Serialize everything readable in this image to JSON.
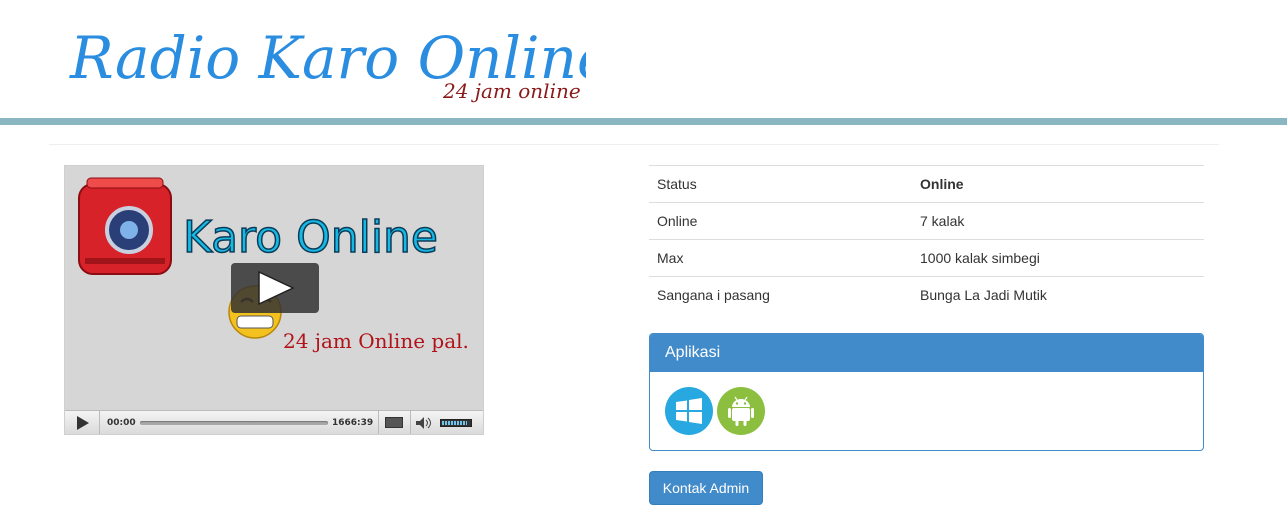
{
  "header": {
    "logo_title": "Radio Karo Online",
    "logo_tagline": "24 jam online",
    "logo_color": "#2a8de0",
    "tagline_color": "#8b1a1a",
    "bar_color": "#8ab6c1"
  },
  "player": {
    "poster_title": "Karo Online",
    "poster_caption": "24 jam Online pal.",
    "current_time": "00:00",
    "duration": "1666:39",
    "volume_level": 0.9,
    "icons": {
      "big_play": "play-icon",
      "play": "play-icon",
      "fullscreen": "screen-icon",
      "volume": "speaker-icon"
    }
  },
  "info": {
    "rows": [
      {
        "key": "Status",
        "value": "Online"
      },
      {
        "key": "Online",
        "value": "7 kalak"
      },
      {
        "key": "Max",
        "value": "1000 kalak simbegi"
      },
      {
        "key": "Sangana i pasang",
        "value": "Bunga La Jadi Mutik"
      }
    ]
  },
  "apps_panel": {
    "heading": "Aplikasi",
    "apps": [
      {
        "icon": "windows-icon",
        "color": "#27a8e0"
      },
      {
        "icon": "android-icon",
        "color": "#8cbf3f"
      }
    ]
  },
  "contact_button": {
    "label": "Kontak Admin",
    "color": "#428bca"
  }
}
